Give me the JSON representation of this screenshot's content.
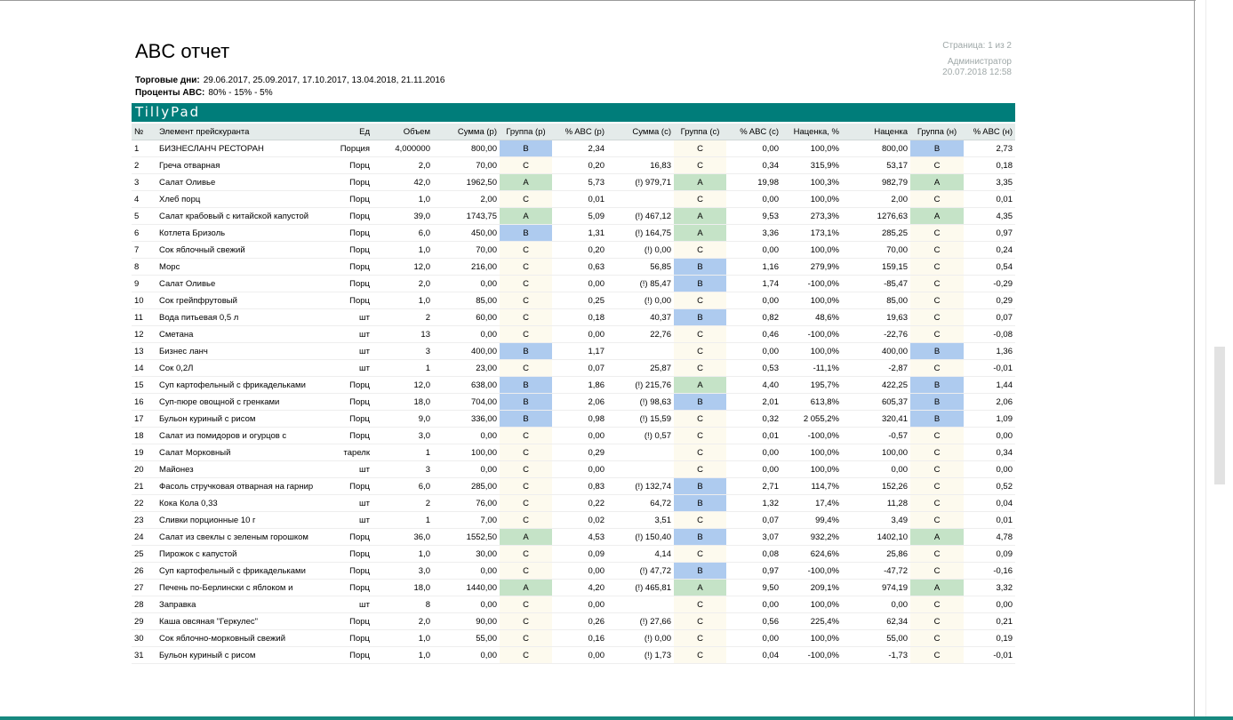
{
  "report": {
    "title": "ABC отчет",
    "trading_days_label": "Торговые дни:",
    "trading_days": "29.06.2017, 25.09.2017, 17.10.2017, 13.04.2018, 21.11.2016",
    "abc_percent_label": "Проценты ABC:",
    "abc_percent": "80% - 15% - 5%",
    "page_info": "Страница: 1 из 2",
    "user": "Администратор",
    "datetime": "20.07.2018 12:58",
    "brand": "TillyPad"
  },
  "colors": {
    "brand_bar": "#007d7a",
    "group_a": "#c5e3c7",
    "group_b": "#aecbef",
    "group_c": "#fdfaee"
  },
  "table": {
    "columns": [
      "№",
      "Элемент прейскуранта",
      "Ед",
      "Объем",
      "Сумма (р)",
      "Группа (р)",
      "% ABC (р)",
      "Сумма (с)",
      "Группа (с)",
      "% ABC (с)",
      "Наценка, %",
      "Наценка",
      "Группа (н)",
      "% ABC (н)"
    ],
    "rows": [
      {
        "n": "1",
        "name": "БИЗНЕСЛАНЧ РЕСТОРАН",
        "unit": "Порция",
        "vol": "4,000000",
        "sum_r": "800,00",
        "grp_r": "B",
        "abc_r": "2,34",
        "sum_c": "",
        "grp_c": "C",
        "abc_c": "0,00",
        "markup_pct": "100,0%",
        "markup": "800,00",
        "grp_m": "B",
        "abc_m": "2,73"
      },
      {
        "n": "2",
        "name": "Греча отварная",
        "unit": "Порц",
        "vol": "2,0",
        "sum_r": "70,00",
        "grp_r": "C",
        "abc_r": "0,20",
        "sum_c": "16,83",
        "grp_c": "C",
        "abc_c": "0,34",
        "markup_pct": "315,9%",
        "markup": "53,17",
        "grp_m": "C",
        "abc_m": "0,18"
      },
      {
        "n": "3",
        "name": "Салат Оливье",
        "unit": "Порц",
        "vol": "42,0",
        "sum_r": "1962,50",
        "grp_r": "A",
        "abc_r": "5,73",
        "sum_c": "(!) 979,71",
        "grp_c": "A",
        "abc_c": "19,98",
        "markup_pct": "100,3%",
        "markup": "982,79",
        "grp_m": "A",
        "abc_m": "3,35"
      },
      {
        "n": "4",
        "name": "Хлеб порц",
        "unit": "Порц",
        "vol": "1,0",
        "sum_r": "2,00",
        "grp_r": "C",
        "abc_r": "0,01",
        "sum_c": "",
        "grp_c": "C",
        "abc_c": "0,00",
        "markup_pct": "100,0%",
        "markup": "2,00",
        "grp_m": "C",
        "abc_m": "0,01"
      },
      {
        "n": "5",
        "name": "Салат крабовый с китайской капустой",
        "unit": "Порц",
        "vol": "39,0",
        "sum_r": "1743,75",
        "grp_r": "A",
        "abc_r": "5,09",
        "sum_c": "(!) 467,12",
        "grp_c": "A",
        "abc_c": "9,53",
        "markup_pct": "273,3%",
        "markup": "1276,63",
        "grp_m": "A",
        "abc_m": "4,35"
      },
      {
        "n": "6",
        "name": "Котлета Бризоль",
        "unit": "Порц",
        "vol": "6,0",
        "sum_r": "450,00",
        "grp_r": "B",
        "abc_r": "1,31",
        "sum_c": "(!) 164,75",
        "grp_c": "A",
        "abc_c": "3,36",
        "markup_pct": "173,1%",
        "markup": "285,25",
        "grp_m": "C",
        "abc_m": "0,97"
      },
      {
        "n": "7",
        "name": "Сок яблочный свежий",
        "unit": "Порц",
        "vol": "1,0",
        "sum_r": "70,00",
        "grp_r": "C",
        "abc_r": "0,20",
        "sum_c": "(!) 0,00",
        "grp_c": "C",
        "abc_c": "0,00",
        "markup_pct": "100,0%",
        "markup": "70,00",
        "grp_m": "C",
        "abc_m": "0,24"
      },
      {
        "n": "8",
        "name": "Морс",
        "unit": "Порц",
        "vol": "12,0",
        "sum_r": "216,00",
        "grp_r": "C",
        "abc_r": "0,63",
        "sum_c": "56,85",
        "grp_c": "B",
        "abc_c": "1,16",
        "markup_pct": "279,9%",
        "markup": "159,15",
        "grp_m": "C",
        "abc_m": "0,54"
      },
      {
        "n": "9",
        "name": "Салат Оливье",
        "unit": "Порц",
        "vol": "2,0",
        "sum_r": "0,00",
        "grp_r": "C",
        "abc_r": "0,00",
        "sum_c": "(!) 85,47",
        "grp_c": "B",
        "abc_c": "1,74",
        "markup_pct": "-100,0%",
        "markup": "-85,47",
        "grp_m": "C",
        "abc_m": "-0,29"
      },
      {
        "n": "10",
        "name": "Сок грейпфрутовый",
        "unit": "Порц",
        "vol": "1,0",
        "sum_r": "85,00",
        "grp_r": "C",
        "abc_r": "0,25",
        "sum_c": "(!) 0,00",
        "grp_c": "C",
        "abc_c": "0,00",
        "markup_pct": "100,0%",
        "markup": "85,00",
        "grp_m": "C",
        "abc_m": "0,29"
      },
      {
        "n": "11",
        "name": "Вода питьевая 0,5 л",
        "unit": "шт",
        "vol": "2",
        "sum_r": "60,00",
        "grp_r": "C",
        "abc_r": "0,18",
        "sum_c": "40,37",
        "grp_c": "B",
        "abc_c": "0,82",
        "markup_pct": "48,6%",
        "markup": "19,63",
        "grp_m": "C",
        "abc_m": "0,07"
      },
      {
        "n": "12",
        "name": "Сметана",
        "unit": "шт",
        "vol": "13",
        "sum_r": "0,00",
        "grp_r": "C",
        "abc_r": "0,00",
        "sum_c": "22,76",
        "grp_c": "C",
        "abc_c": "0,46",
        "markup_pct": "-100,0%",
        "markup": "-22,76",
        "grp_m": "C",
        "abc_m": "-0,08"
      },
      {
        "n": "13",
        "name": "Бизнес ланч",
        "unit": "шт",
        "vol": "3",
        "sum_r": "400,00",
        "grp_r": "B",
        "abc_r": "1,17",
        "sum_c": "",
        "grp_c": "C",
        "abc_c": "0,00",
        "markup_pct": "100,0%",
        "markup": "400,00",
        "grp_m": "B",
        "abc_m": "1,36"
      },
      {
        "n": "14",
        "name": "Сок 0,2Л",
        "unit": "шт",
        "vol": "1",
        "sum_r": "23,00",
        "grp_r": "C",
        "abc_r": "0,07",
        "sum_c": "25,87",
        "grp_c": "C",
        "abc_c": "0,53",
        "markup_pct": "-11,1%",
        "markup": "-2,87",
        "grp_m": "C",
        "abc_m": "-0,01"
      },
      {
        "n": "15",
        "name": "Суп картофельный с фрикадельками",
        "unit": "Порц",
        "vol": "12,0",
        "sum_r": "638,00",
        "grp_r": "B",
        "abc_r": "1,86",
        "sum_c": "(!) 215,76",
        "grp_c": "A",
        "abc_c": "4,40",
        "markup_pct": "195,7%",
        "markup": "422,25",
        "grp_m": "B",
        "abc_m": "1,44"
      },
      {
        "n": "16",
        "name": "Суп-пюре овощной с гренками",
        "unit": "Порц",
        "vol": "18,0",
        "sum_r": "704,00",
        "grp_r": "B",
        "abc_r": "2,06",
        "sum_c": "(!) 98,63",
        "grp_c": "B",
        "abc_c": "2,01",
        "markup_pct": "613,8%",
        "markup": "605,37",
        "grp_m": "B",
        "abc_m": "2,06"
      },
      {
        "n": "17",
        "name": "Бульон куриный с рисом",
        "unit": "Порц",
        "vol": "9,0",
        "sum_r": "336,00",
        "grp_r": "B",
        "abc_r": "0,98",
        "sum_c": "(!) 15,59",
        "grp_c": "C",
        "abc_c": "0,32",
        "markup_pct": "2 055,2%",
        "markup": "320,41",
        "grp_m": "B",
        "abc_m": "1,09"
      },
      {
        "n": "18",
        "name": "Салат из помидоров и огурцов с",
        "unit": "Порц",
        "vol": "3,0",
        "sum_r": "0,00",
        "grp_r": "C",
        "abc_r": "0,00",
        "sum_c": "(!) 0,57",
        "grp_c": "C",
        "abc_c": "0,01",
        "markup_pct": "-100,0%",
        "markup": "-0,57",
        "grp_m": "C",
        "abc_m": "0,00"
      },
      {
        "n": "19",
        "name": "Салат Морковный",
        "unit": "тарелк",
        "vol": "1",
        "sum_r": "100,00",
        "grp_r": "C",
        "abc_r": "0,29",
        "sum_c": "",
        "grp_c": "C",
        "abc_c": "0,00",
        "markup_pct": "100,0%",
        "markup": "100,00",
        "grp_m": "C",
        "abc_m": "0,34"
      },
      {
        "n": "20",
        "name": "Майонез",
        "unit": "шт",
        "vol": "3",
        "sum_r": "0,00",
        "grp_r": "C",
        "abc_r": "0,00",
        "sum_c": "",
        "grp_c": "C",
        "abc_c": "0,00",
        "markup_pct": "100,0%",
        "markup": "0,00",
        "grp_m": "C",
        "abc_m": "0,00"
      },
      {
        "n": "21",
        "name": "Фасоль стручковая отварная на гарнир",
        "unit": "Порц",
        "vol": "6,0",
        "sum_r": "285,00",
        "grp_r": "C",
        "abc_r": "0,83",
        "sum_c": "(!) 132,74",
        "grp_c": "B",
        "abc_c": "2,71",
        "markup_pct": "114,7%",
        "markup": "152,26",
        "grp_m": "C",
        "abc_m": "0,52"
      },
      {
        "n": "22",
        "name": "Кока Кола 0,33",
        "unit": "шт",
        "vol": "2",
        "sum_r": "76,00",
        "grp_r": "C",
        "abc_r": "0,22",
        "sum_c": "64,72",
        "grp_c": "B",
        "abc_c": "1,32",
        "markup_pct": "17,4%",
        "markup": "11,28",
        "grp_m": "C",
        "abc_m": "0,04"
      },
      {
        "n": "23",
        "name": "Сливки порционные 10 г",
        "unit": "шт",
        "vol": "1",
        "sum_r": "7,00",
        "grp_r": "C",
        "abc_r": "0,02",
        "sum_c": "3,51",
        "grp_c": "C",
        "abc_c": "0,07",
        "markup_pct": "99,4%",
        "markup": "3,49",
        "grp_m": "C",
        "abc_m": "0,01"
      },
      {
        "n": "24",
        "name": "Салат из свеклы с зеленым горошком",
        "unit": "Порц",
        "vol": "36,0",
        "sum_r": "1552,50",
        "grp_r": "A",
        "abc_r": "4,53",
        "sum_c": "(!) 150,40",
        "grp_c": "B",
        "abc_c": "3,07",
        "markup_pct": "932,2%",
        "markup": "1402,10",
        "grp_m": "A",
        "abc_m": "4,78"
      },
      {
        "n": "25",
        "name": "Пирожок с капустой",
        "unit": "Порц",
        "vol": "1,0",
        "sum_r": "30,00",
        "grp_r": "C",
        "abc_r": "0,09",
        "sum_c": "4,14",
        "grp_c": "C",
        "abc_c": "0,08",
        "markup_pct": "624,6%",
        "markup": "25,86",
        "grp_m": "C",
        "abc_m": "0,09"
      },
      {
        "n": "26",
        "name": "Суп картофельный с фрикадельками",
        "unit": "Порц",
        "vol": "3,0",
        "sum_r": "0,00",
        "grp_r": "C",
        "abc_r": "0,00",
        "sum_c": "(!) 47,72",
        "grp_c": "B",
        "abc_c": "0,97",
        "markup_pct": "-100,0%",
        "markup": "-47,72",
        "grp_m": "C",
        "abc_m": "-0,16"
      },
      {
        "n": "27",
        "name": "Печень по-Берлински с яблоком и",
        "unit": "Порц",
        "vol": "18,0",
        "sum_r": "1440,00",
        "grp_r": "A",
        "abc_r": "4,20",
        "sum_c": "(!) 465,81",
        "grp_c": "A",
        "abc_c": "9,50",
        "markup_pct": "209,1%",
        "markup": "974,19",
        "grp_m": "A",
        "abc_m": "3,32"
      },
      {
        "n": "28",
        "name": "Заправка",
        "unit": "шт",
        "vol": "8",
        "sum_r": "0,00",
        "grp_r": "C",
        "abc_r": "0,00",
        "sum_c": "",
        "grp_c": "C",
        "abc_c": "0,00",
        "markup_pct": "100,0%",
        "markup": "0,00",
        "grp_m": "C",
        "abc_m": "0,00"
      },
      {
        "n": "29",
        "name": "Каша овсяная \"Геркулес\"",
        "unit": "Порц",
        "vol": "2,0",
        "sum_r": "90,00",
        "grp_r": "C",
        "abc_r": "0,26",
        "sum_c": "(!) 27,66",
        "grp_c": "C",
        "abc_c": "0,56",
        "markup_pct": "225,4%",
        "markup": "62,34",
        "grp_m": "C",
        "abc_m": "0,21"
      },
      {
        "n": "30",
        "name": "Сок яблочно-морковный свежий",
        "unit": "Порц",
        "vol": "1,0",
        "sum_r": "55,00",
        "grp_r": "C",
        "abc_r": "0,16",
        "sum_c": "(!) 0,00",
        "grp_c": "C",
        "abc_c": "0,00",
        "markup_pct": "100,0%",
        "markup": "55,00",
        "grp_m": "C",
        "abc_m": "0,19"
      },
      {
        "n": "31",
        "name": "Бульон куриный с рисом",
        "unit": "Порц",
        "vol": "1,0",
        "sum_r": "0,00",
        "grp_r": "C",
        "abc_r": "0,00",
        "sum_c": "(!) 1,73",
        "grp_c": "C",
        "abc_c": "0,04",
        "markup_pct": "-100,0%",
        "markup": "-1,73",
        "grp_m": "C",
        "abc_m": "-0,01"
      }
    ]
  }
}
